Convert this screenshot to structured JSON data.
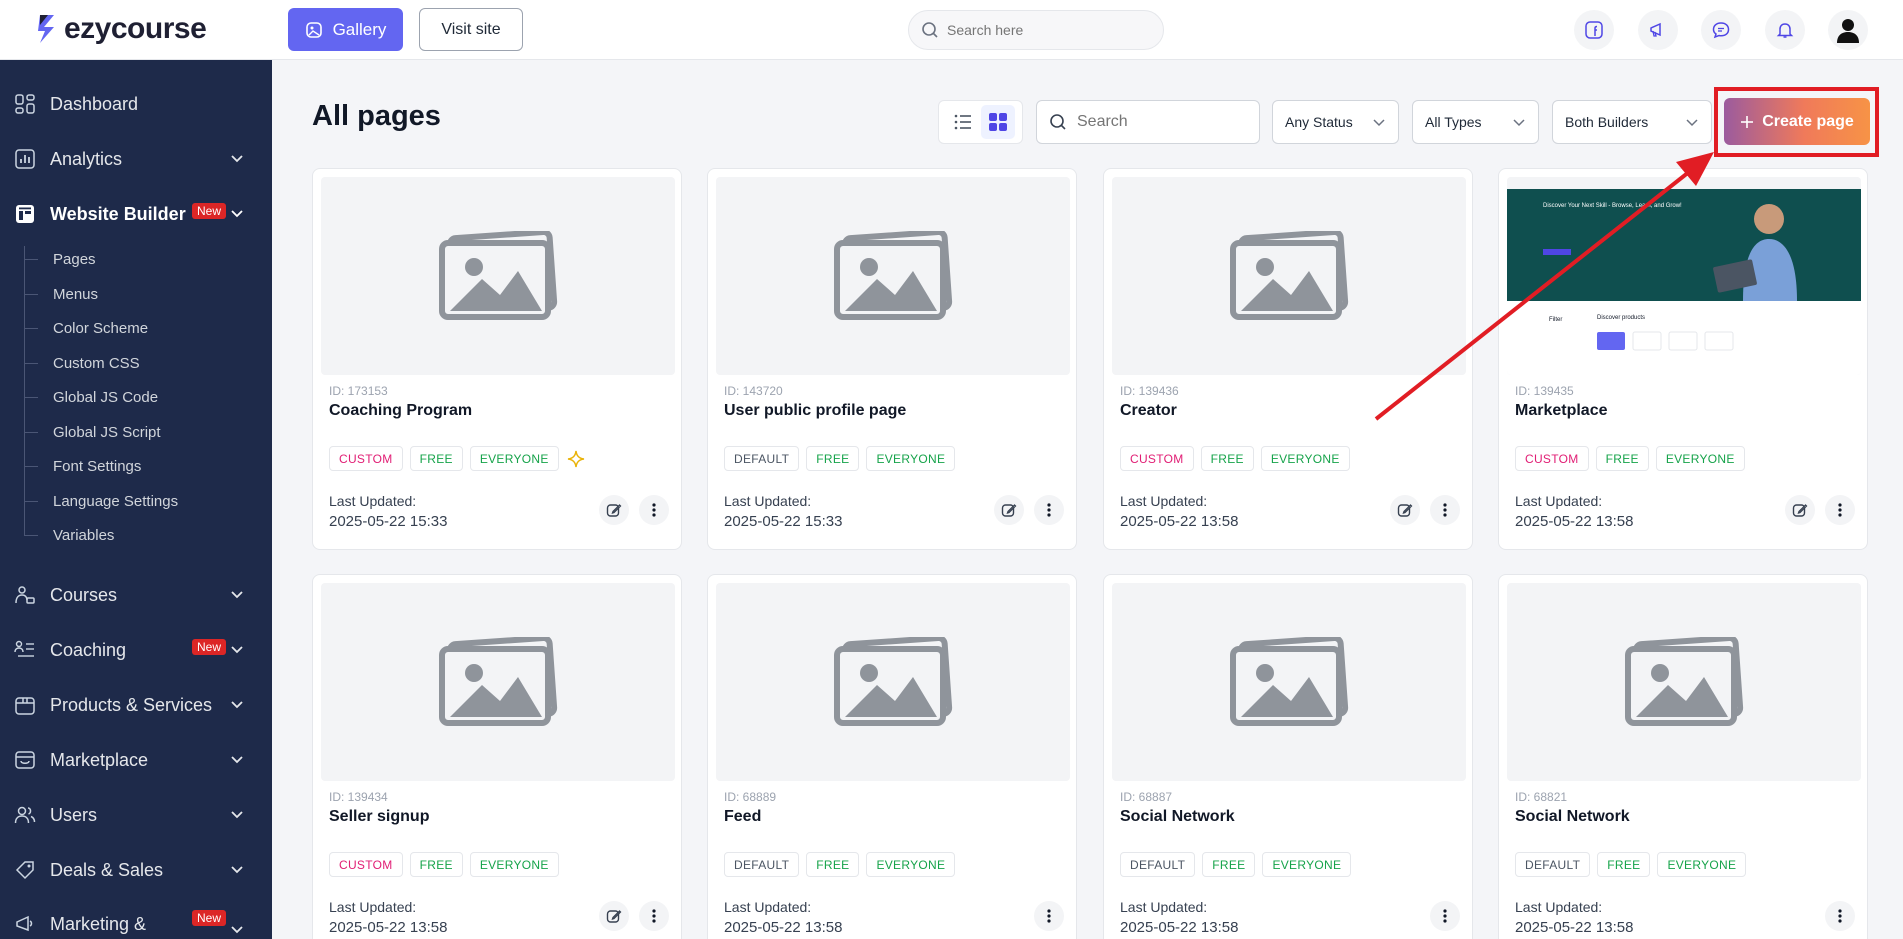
{
  "brand": {
    "name": "ezycourse"
  },
  "topbar": {
    "gallery_label": "Gallery",
    "visit_label": "Visit site",
    "search_placeholder": "Search here"
  },
  "sidebar": {
    "items": [
      {
        "label": "Dashboard",
        "icon": "dashboard-icon"
      },
      {
        "label": "Analytics",
        "icon": "analytics-icon"
      },
      {
        "label": "Website Builder",
        "icon": "website-builder-icon",
        "badge": "New"
      },
      {
        "label": "Courses",
        "icon": "courses-icon"
      },
      {
        "label": "Coaching",
        "icon": "coaching-icon",
        "badge": "New"
      },
      {
        "label": "Products & Services",
        "icon": "products-icon"
      },
      {
        "label": "Marketplace",
        "icon": "marketplace-icon"
      },
      {
        "label": "Users",
        "icon": "users-icon"
      },
      {
        "label": "Deals & Sales",
        "icon": "deals-icon"
      },
      {
        "label": "Marketing &",
        "icon": "marketing-icon",
        "badge": "New"
      }
    ],
    "sub_items": [
      "Pages",
      "Menus",
      "Color Scheme",
      "Custom CSS",
      "Global JS Code",
      "Global JS Script",
      "Font Settings",
      "Language Settings",
      "Variables"
    ]
  },
  "main": {
    "title": "All pages",
    "search_placeholder": "Search",
    "filters": {
      "status": "Any Status",
      "types": "All Types",
      "builders": "Both Builders"
    },
    "create_label": "Create page",
    "last_updated_label": "Last Updated:"
  },
  "pages": [
    {
      "id": "ID: 173153",
      "name": "Coaching Program",
      "tags": [
        "CUSTOM",
        "FREE",
        "EVERYONE"
      ],
      "date": "2025-05-22 15:33"
    },
    {
      "id": "ID: 143720",
      "name": "User public profile page",
      "tags": [
        "DEFAULT",
        "FREE",
        "EVERYONE"
      ],
      "date": "2025-05-22 15:33"
    },
    {
      "id": "ID: 139436",
      "name": "Creator",
      "tags": [
        "CUSTOM",
        "FREE",
        "EVERYONE"
      ],
      "date": "2025-05-22 13:58"
    },
    {
      "id": "ID: 139435",
      "name": "Marketplace",
      "tags": [
        "CUSTOM",
        "FREE",
        "EVERYONE"
      ],
      "date": "2025-05-22 13:58"
    },
    {
      "id": "ID: 139434",
      "name": "Seller signup",
      "tags": [
        "CUSTOM",
        "FREE",
        "EVERYONE"
      ],
      "date": "2025-05-22 13:58"
    },
    {
      "id": "ID: 68889",
      "name": "Feed",
      "tags": [
        "DEFAULT",
        "FREE",
        "EVERYONE"
      ],
      "date": "2025-05-22 13:58"
    },
    {
      "id": "ID: 68887",
      "name": "Social Network",
      "tags": [
        "DEFAULT",
        "FREE",
        "EVERYONE"
      ],
      "date": "2025-05-22 13:58"
    },
    {
      "id": "ID: 68821",
      "name": "Social Network",
      "tags": [
        "DEFAULT",
        "FREE",
        "EVERYONE"
      ],
      "date": "2025-05-22 13:58"
    }
  ],
  "marketplace_thumb": {
    "hero_heading": "Discover Your Next Skill - Browse, Learn, and Grow!",
    "filter_label": "Filter",
    "products_label": "Discover products"
  },
  "colors": {
    "accent": "#6366f1",
    "sidebar": "#1e2a4a",
    "custom_tag": "#e11d74",
    "green_tag": "#16a34a",
    "highlight": "#e11d24"
  }
}
